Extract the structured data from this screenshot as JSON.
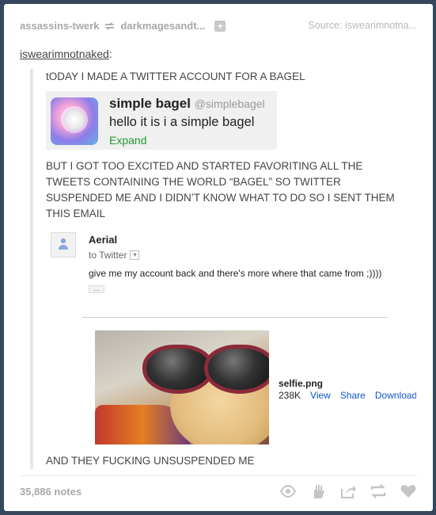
{
  "header": {
    "reblogged_from": "assassins-twerk",
    "blog": "darkmagesandt...",
    "source_label": "Source:",
    "source_blog": "iswearimnotna..."
  },
  "reblogger": {
    "name": "iswearimnotnaked",
    "colon": ":"
  },
  "post": {
    "line1": "tODAY I MADE A TWITTER ACCOUNT FOR A BAGEL",
    "line2_a": "BUT I GOT TOO EXCITED AND STARTED FAVORITING ALL THE",
    "line2_b": "TWEETS CONTAINING THE WORLD “BAGEL” SO TWITTER",
    "line2_c": "SUSPENDED ME AND I DIDN’T KNOW WHAT TO DO SO I SENT THEM",
    "line2_d": "THIS EMAIL",
    "final": "AND THEY FUCKING UNSUSPENDED ME"
  },
  "tweet": {
    "name": "simple bagel",
    "handle": "@simplebagel",
    "text": "hello it is i a simple bagel",
    "expand": "Expand"
  },
  "email": {
    "from": "Aerial",
    "to": "to Twitter",
    "body": "give me my account back and there's more where that came from ;))))",
    "more": "..."
  },
  "attachment": {
    "filename": "selfie.png",
    "size": "238K",
    "view": "View",
    "share": "Share",
    "download": "Download"
  },
  "footer": {
    "notes": "35,886 notes"
  },
  "icons": {
    "reblog": "reblog-icon",
    "follow": "plus-icon",
    "view": "eye-icon",
    "hand": "hand-icon",
    "share": "share-icon",
    "reblog_action": "reblog-icon",
    "like": "heart-icon"
  }
}
